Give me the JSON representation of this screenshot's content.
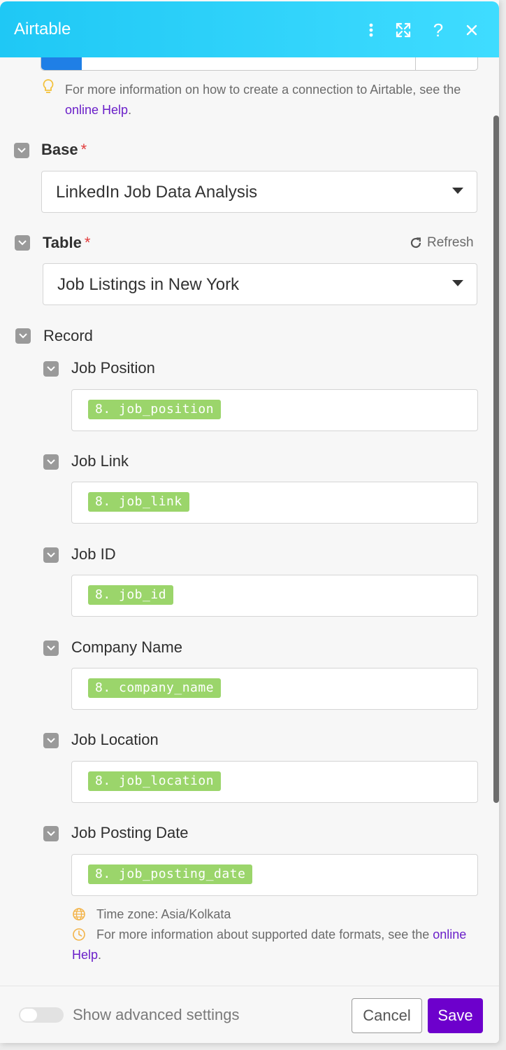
{
  "header": {
    "title": "Airtable"
  },
  "connection": {
    "hint_text": "For more information on how to create a connection to Airtable, see the ",
    "hint_link": "online Help",
    "hint_end": "."
  },
  "base": {
    "label": "Base",
    "required_mark": "*",
    "value": "LinkedIn Job Data Analysis"
  },
  "table": {
    "label": "Table",
    "required_mark": "*",
    "value": "Job Listings in New York",
    "refresh_label": "Refresh"
  },
  "record": {
    "label": "Record",
    "fields": [
      {
        "label": "Job Position",
        "pill": "8. job_position"
      },
      {
        "label": "Job Link",
        "pill": "8. job_link"
      },
      {
        "label": "Job ID",
        "pill": "8. job_id"
      },
      {
        "label": "Company Name",
        "pill": "8. company_name"
      },
      {
        "label": "Job Location",
        "pill": "8. job_location"
      },
      {
        "label": "Job Posting Date",
        "pill": "8. job_posting_date"
      }
    ],
    "timezone_hint": "Time zone: Asia/Kolkata",
    "date_hint": "For more information about supported date formats, see the ",
    "date_hint_link": "online Help",
    "date_hint_end": "."
  },
  "footer": {
    "advanced_label": "Show advanced settings",
    "advanced_on": false,
    "cancel_label": "Cancel",
    "save_label": "Save"
  },
  "colors": {
    "header": "#1fc8f5",
    "save": "#6d00cc",
    "pill": "#9bd56b",
    "link": "#6a1fc9",
    "required": "#e23b3b"
  }
}
